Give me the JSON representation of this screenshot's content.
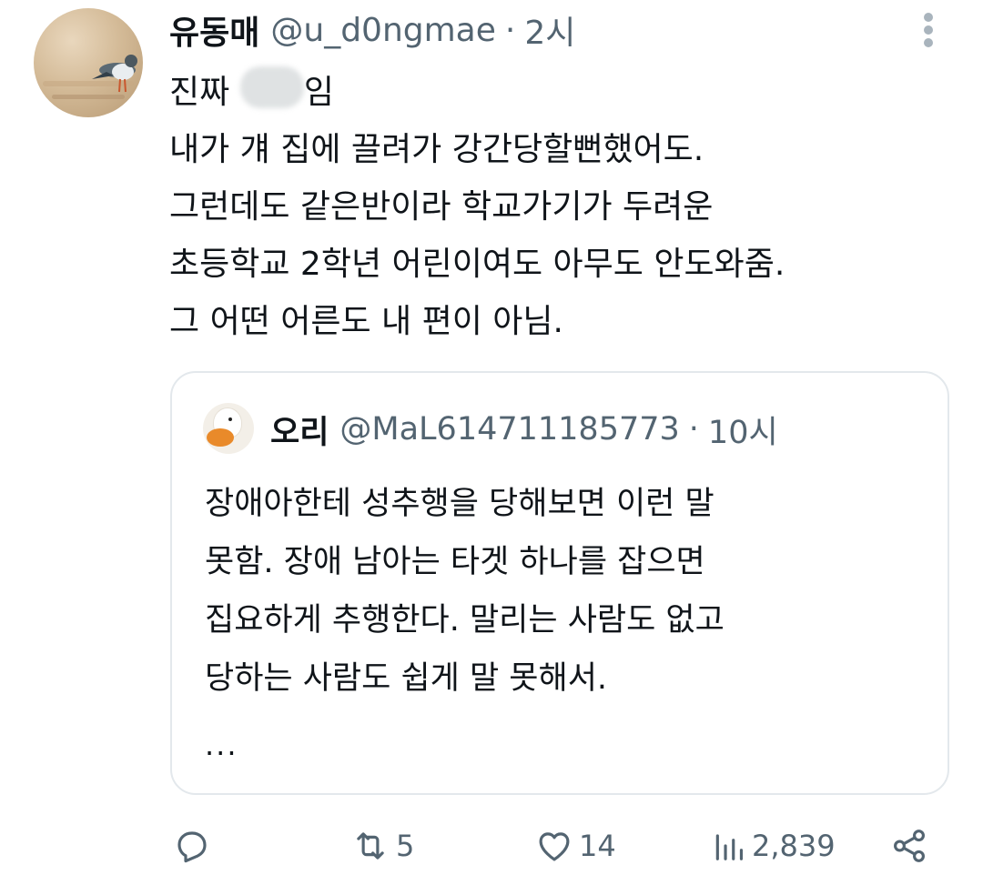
{
  "tweet": {
    "author_name": "유동매",
    "author_handle": "@u_d0ngmae",
    "separator": "·",
    "time": "2시",
    "lines": [
      "진짜 ",
      "임",
      "내가 걔 집에 끌려가 강간당할뻔했어도.",
      "그런데도 같은반이라 학교가기가 두려운",
      "초등학교 2학년 어린이여도 아무도 안도와줌.",
      "그 어떤 어른도 내 편이 아님."
    ]
  },
  "quote": {
    "author_name": "오리",
    "author_handle": "@MaL614711185773",
    "separator": "·",
    "time": "10시",
    "lines": [
      "장애아한테 성추행을 당해보면 이런 말",
      "못함. 장애 남아는 타겟 하나를 잡으면",
      "집요하게 추행한다. 말리는 사람도 없고",
      "당하는 사람도 쉽게 말 못해서."
    ],
    "ellipsis": "..."
  },
  "actions": {
    "reply_count": "",
    "retweet_count": "5",
    "like_count": "14",
    "views_count": "2,839"
  },
  "icons": {
    "reply": "reply-icon",
    "retweet": "retweet-icon",
    "like": "heart-icon",
    "views": "views-icon",
    "share": "share-icon",
    "more": "more-vertical-icon"
  },
  "colors": {
    "text": "#0f1419",
    "secondary": "#536471",
    "border": "#e3e8ec"
  }
}
